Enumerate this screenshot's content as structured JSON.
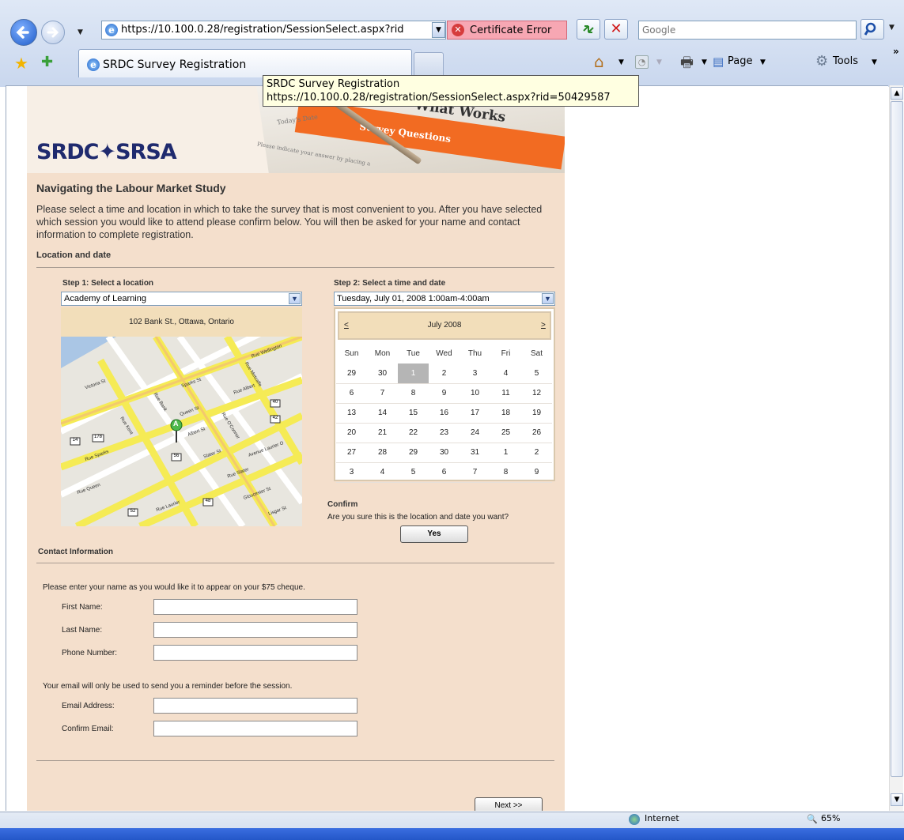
{
  "browser": {
    "address": "https://10.100.0.28/registration/SessionSelect.aspx?rid",
    "cert_error": "Certificate Error",
    "search_placeholder": "Google",
    "tab_title": "SRDC Survey Registration",
    "toolbar": {
      "page_label": "Page",
      "tools_label": "Tools"
    },
    "tooltip": {
      "title": "SRDC Survey Registration",
      "url": "https://10.100.0.28/registration/SessionSelect.aspx?rid=50429587"
    },
    "status": {
      "zone": "Internet",
      "zoom": "65%"
    }
  },
  "banner": {
    "logo": "SRDC✦SRSA",
    "headline": "What Works",
    "subline": "Survey Questions",
    "form_small_1": "Today's Date",
    "form_small_2": "Please indicate your answer by placing a"
  },
  "page": {
    "title": "Navigating the Labour Market Study",
    "intro": "Please select a time and location in which to take the survey that is most convenient to you. After you have selected which session you would like to attend please confirm below. You will then be asked for your name and contact information to complete registration.",
    "section_location": "Location and date"
  },
  "step1": {
    "label": "Step 1: Select a location",
    "selected": "Academy of Learning",
    "address": "102 Bank St., Ottawa, Ontario"
  },
  "map": {
    "streets": [
      "Rue Wellington",
      "Rue Sparks",
      "Rue Queen",
      "Rue Albert",
      "Rue Slater",
      "Rue Laurier",
      "Rue Bank",
      "Rue O'Connor",
      "Rue Metcalfe",
      "Sparks St",
      "Queen St",
      "Albert St",
      "Slater St",
      "Gloucester St",
      "Lisgar St",
      "Avenue Laurier O",
      "Rue Kent",
      "Victoria St"
    ],
    "marker": "A",
    "shields": [
      "14",
      "178",
      "40",
      "42",
      "56",
      "48",
      "52"
    ]
  },
  "step2": {
    "label": "Step 2: Select a time and date",
    "selected": "Tuesday, July 01, 2008 1:00am-4:00am"
  },
  "calendar": {
    "prev": "<",
    "next": ">",
    "month": "July 2008",
    "days": [
      "Sun",
      "Mon",
      "Tue",
      "Wed",
      "Thu",
      "Fri",
      "Sat"
    ],
    "weeks": [
      [
        "29",
        "30",
        "1",
        "2",
        "3",
        "4",
        "5"
      ],
      [
        "6",
        "7",
        "8",
        "9",
        "10",
        "11",
        "12"
      ],
      [
        "13",
        "14",
        "15",
        "16",
        "17",
        "18",
        "19"
      ],
      [
        "20",
        "21",
        "22",
        "23",
        "24",
        "25",
        "26"
      ],
      [
        "27",
        "28",
        "29",
        "30",
        "31",
        "1",
        "2"
      ],
      [
        "3",
        "4",
        "5",
        "6",
        "7",
        "8",
        "9"
      ]
    ],
    "selected_day": "1"
  },
  "confirm": {
    "heading": "Confirm",
    "question": "Are you sure this is the location and date you want?",
    "yes_label": "Yes"
  },
  "contact": {
    "heading": "Contact Information",
    "name_note": "Please enter your name as you would like it to appear on your $75 cheque.",
    "first_name": "First Name:",
    "last_name": "Last Name:",
    "phone": "Phone Number:",
    "email_note": "Your email will only be used to send you a reminder before the session.",
    "email": "Email Address:",
    "confirm_email": "Confirm Email:",
    "next_label": "Next >>"
  }
}
